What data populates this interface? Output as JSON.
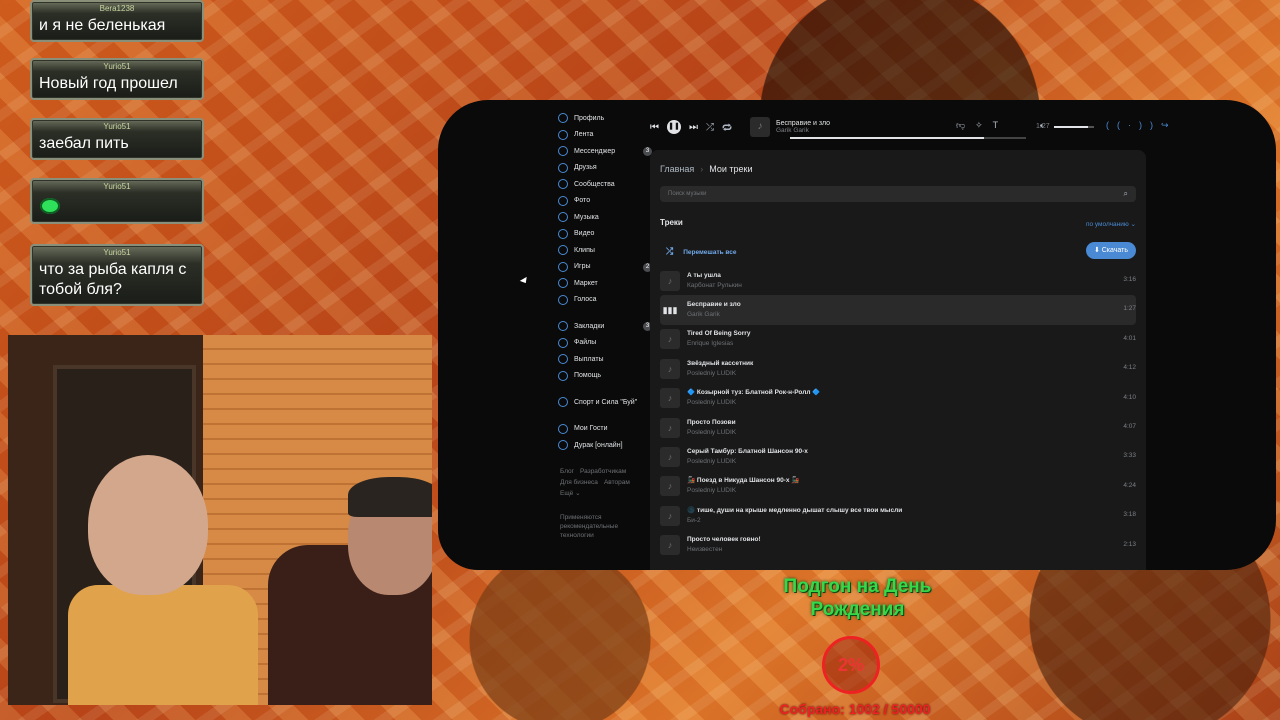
{
  "chat": [
    {
      "user": "Bera1238",
      "text": "и я не беленькая"
    },
    {
      "user": "Yurio51",
      "text": "Новый год прошел"
    },
    {
      "user": "Yurio51",
      "text": "заебал пить"
    },
    {
      "user": "Yurio51",
      "text": ""
    },
    {
      "user": "Yurio51",
      "text": "что за рыба капля с тобой бля?"
    }
  ],
  "sidebar": {
    "items": [
      {
        "label": "Профиль",
        "badge": ""
      },
      {
        "label": "Лента",
        "badge": ""
      },
      {
        "label": "Мессенджер",
        "badge": "3"
      },
      {
        "label": "Друзья",
        "badge": ""
      },
      {
        "label": "Сообщества",
        "badge": ""
      },
      {
        "label": "Фото",
        "badge": ""
      },
      {
        "label": "Музыка",
        "badge": ""
      },
      {
        "label": "Видео",
        "badge": ""
      },
      {
        "label": "Клипы",
        "badge": ""
      },
      {
        "label": "Игры",
        "badge": "2"
      },
      {
        "label": "Маркет",
        "badge": ""
      },
      {
        "label": "Голоса",
        "badge": ""
      }
    ],
    "items2": [
      {
        "label": "Закладки",
        "badge": "3"
      },
      {
        "label": "Файлы",
        "badge": ""
      },
      {
        "label": "Выплаты",
        "badge": ""
      },
      {
        "label": "Помощь",
        "badge": ""
      }
    ],
    "groups": [
      {
        "label": "Спорт и Сила \"Буй\""
      }
    ],
    "apps": [
      {
        "label": "Мои Гости"
      },
      {
        "label": "Дурак [онлайн]"
      }
    ],
    "footer": {
      "blog": "Блог",
      "devs": "Разработчикам",
      "business": "Для бизнеса",
      "authors": "Авторам",
      "more": "Ещё ⌄"
    },
    "recs": "Применяются рекомендательные технологии"
  },
  "player": {
    "title": "Бесправие и зло",
    "artist": "Garik Garik",
    "time": "1:27",
    "progress": 0.82,
    "volume": 0.85
  },
  "content": {
    "crumb_home": "Главная",
    "crumb_current": "Мои треки",
    "search_placeholder": "Поиск музыки",
    "tracks_heading": "Треки",
    "sort_label": "по умолчанию ⌄",
    "shuffle_label": "Перемешать все",
    "download_label": "Скачать",
    "tracks": [
      {
        "title": "А ты ушла",
        "artist": "Карбонат Рулькин",
        "duration": "3:16",
        "active": false
      },
      {
        "title": "Бесправие и зло",
        "artist": "Garik Garik",
        "duration": "1:27",
        "active": true
      },
      {
        "title": "Tired Of Being Sorry",
        "artist": "Enrique Iglesias",
        "duration": "4:01",
        "active": false
      },
      {
        "title": "Звёздный кассетник",
        "artist": "Posledniy LUDIK",
        "duration": "4:12",
        "active": false
      },
      {
        "title": "🔷 Козырной туз: Блатной Рок-н-Ролл 🔷",
        "artist": "Posledniy LUDIK",
        "duration": "4:10",
        "active": false
      },
      {
        "title": "Просто Позови",
        "artist": "Posledniy LUDIK",
        "duration": "4:07",
        "active": false
      },
      {
        "title": "Серый Тамбур: Блатной Шансон 90-х",
        "artist": "Posledniy LUDIK",
        "duration": "3:33",
        "active": false
      },
      {
        "title": "🚂 Поезд в Никуда Шансон 90-х 🚂",
        "artist": "Posledniy LUDIK",
        "duration": "4:24",
        "active": false
      },
      {
        "title": "🌑 тише, души на крыше медленно дышат слышу все твои мысли",
        "artist": "Би-2",
        "duration": "3:18",
        "active": false
      },
      {
        "title": "Просто человек говно!",
        "artist": "Неизвестен",
        "duration": "2:13",
        "active": false
      }
    ]
  },
  "goal": {
    "title": "Подгон на День Рождения",
    "percent": "2%",
    "collected": "Собрано: 1002 / 50000"
  }
}
